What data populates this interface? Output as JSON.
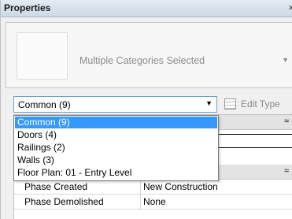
{
  "window": {
    "title": "Properties",
    "close_glyph": "×"
  },
  "type_selector": {
    "thumbnail_icon": "type-thumbnail",
    "label": "Multiple Categories Selected",
    "arrow_glyph": "▼"
  },
  "filter": {
    "selected": "Common (9)",
    "caret_glyph": "▼"
  },
  "edit_type": {
    "label": "Edit Type",
    "icon": "edit-type-icon",
    "enabled": false
  },
  "dropdown": {
    "options": [
      {
        "label": "Common (9)",
        "selected": true
      },
      {
        "label": "Doors (4)",
        "selected": false
      },
      {
        "label": "Railings (2)",
        "selected": false
      },
      {
        "label": "Walls (3)",
        "selected": false
      },
      {
        "label": "Floor Plan: 01 - Entry Level",
        "selected": false
      }
    ]
  },
  "properties": {
    "collapse_glyph": "≈",
    "rows": [
      {
        "name": "Phase Created",
        "value": "New Construction"
      },
      {
        "name": "Phase Demolished",
        "value": "None"
      }
    ]
  },
  "colors": {
    "selection": "#3399ff",
    "group_header": "#e3e3e3",
    "title_bar": "#cdd9e7"
  }
}
